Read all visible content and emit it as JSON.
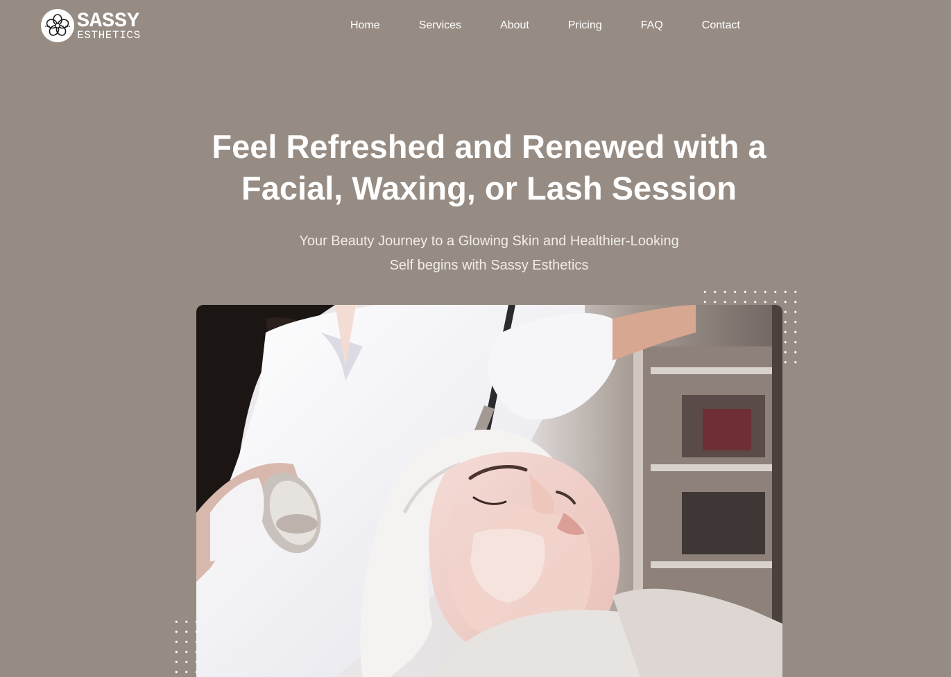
{
  "brand": {
    "name": "SASSY",
    "tagline": "ESTHETICS",
    "logo_icon": "flower-icon"
  },
  "nav": {
    "items": [
      {
        "label": "Home"
      },
      {
        "label": "Services"
      },
      {
        "label": "About"
      },
      {
        "label": "Pricing"
      },
      {
        "label": "FAQ"
      },
      {
        "label": "Contact"
      }
    ]
  },
  "hero": {
    "title_line1": "Feel Refreshed and Renewed with a",
    "title_line2": "Facial, Waxing, or Lash Session",
    "subtitle_line1": "Your Beauty Journey to a Glowing Skin and Healthier-Looking",
    "subtitle_line2": "Self begins with Sassy Esthetics"
  },
  "colors": {
    "background": "#968c83",
    "text": "#ffffff",
    "subtitle_text": "#f1ede9"
  }
}
